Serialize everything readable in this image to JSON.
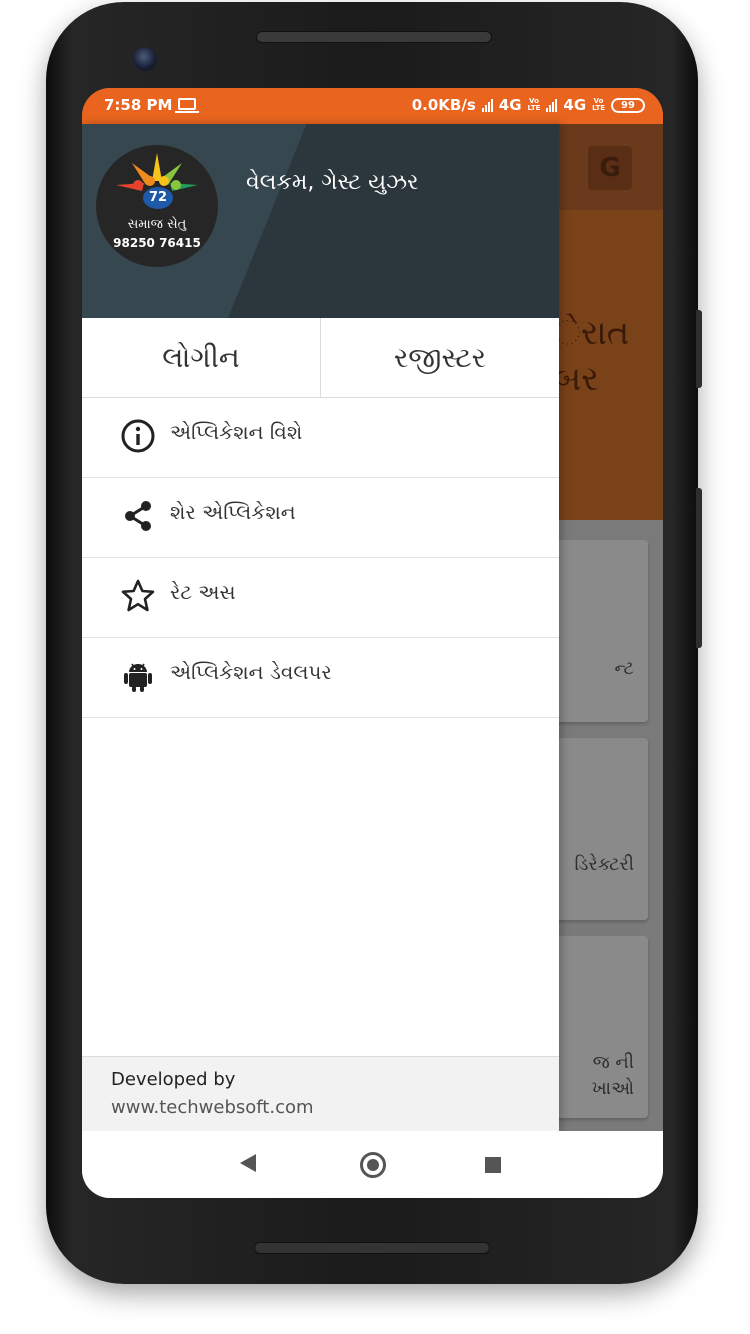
{
  "status_bar": {
    "time": "7:58 PM",
    "network_speed": "0.0KB/s",
    "network_1": "4G",
    "network_2": "4G",
    "volte_label": "Vo\nLTE",
    "battery": "99"
  },
  "background_app": {
    "banner_text_line1": "ેરાત",
    "banner_text_line2": "બર",
    "cards": [
      {
        "label": "ન્ટ"
      },
      {
        "label": "ડિરેક્ટરી"
      },
      {
        "label_line1": "જ ની",
        "label_line2": "ખાઓ"
      }
    ]
  },
  "drawer": {
    "logo": {
      "number": "72",
      "name": "સમાજ સેતુ",
      "phone": "98250 76415"
    },
    "welcome_text": "વેલકમ, ગેસ્ટ યુઝર",
    "login_label": "લોગીન",
    "register_label": "રજીસ્ટર",
    "menu": [
      {
        "label": "એપ્લિકેશન વિશે",
        "icon": "info-icon"
      },
      {
        "label": "શેર એપ્લિકેશન",
        "icon": "share-icon"
      },
      {
        "label": "રેટ અસ",
        "icon": "star-icon"
      },
      {
        "label": "એપ્લિકેશન ડેવલપર",
        "icon": "android-icon"
      }
    ],
    "footer": {
      "developed_by": "Developed by",
      "website": "www.techwebsoft.com"
    }
  },
  "colors": {
    "status_bar": "#e8641f",
    "drawer_header": "#37474f",
    "text_primary": "#333333"
  }
}
